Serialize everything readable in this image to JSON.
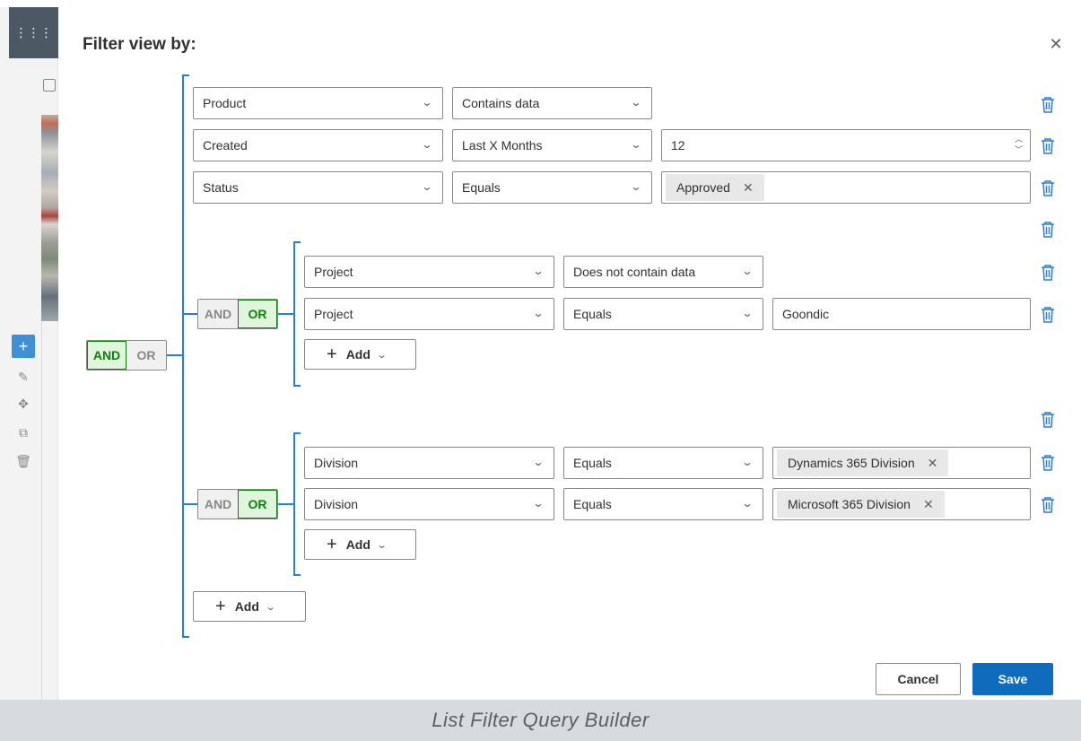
{
  "dialog": {
    "title": "Filter view by:",
    "close_icon": "close-icon"
  },
  "rail": {
    "launcher_icon": "app-launcher-icon",
    "add_icon": "add-icon",
    "tools": [
      "edit-icon",
      "move-icon",
      "copy-icon",
      "delete-icon"
    ]
  },
  "root_group": {
    "and_label": "AND",
    "or_label": "OR",
    "active": "AND",
    "conditions": [
      {
        "field": "Product",
        "operator": "Contains data",
        "value": ""
      },
      {
        "field": "Created",
        "operator": "Last X Months",
        "value": "12"
      },
      {
        "field": "Status",
        "operator": "Equals",
        "value_tag": "Approved"
      }
    ],
    "add_label": "Add"
  },
  "group1": {
    "and_label": "AND",
    "or_label": "OR",
    "active": "OR",
    "conditions": [
      {
        "field": "Project",
        "operator": "Does not contain data",
        "value": ""
      },
      {
        "field": "Project",
        "operator": "Equals",
        "value": "Goondic"
      }
    ],
    "add_label": "Add"
  },
  "group2": {
    "and_label": "AND",
    "or_label": "OR",
    "active": "OR",
    "conditions": [
      {
        "field": "Division",
        "operator": "Equals",
        "value_tag": "Dynamics 365 Division"
      },
      {
        "field": "Division",
        "operator": "Equals",
        "value_tag": "Microsoft 365 Division"
      }
    ],
    "add_label": "Add"
  },
  "footer": {
    "cancel_label": "Cancel",
    "save_label": "Save"
  },
  "caption": "List Filter Query Builder",
  "colors": {
    "accent": "#2a7fd4",
    "active_green": "#107c10",
    "active_green_bg": "#dff6dd",
    "save_blue": "#0f6cbd"
  }
}
